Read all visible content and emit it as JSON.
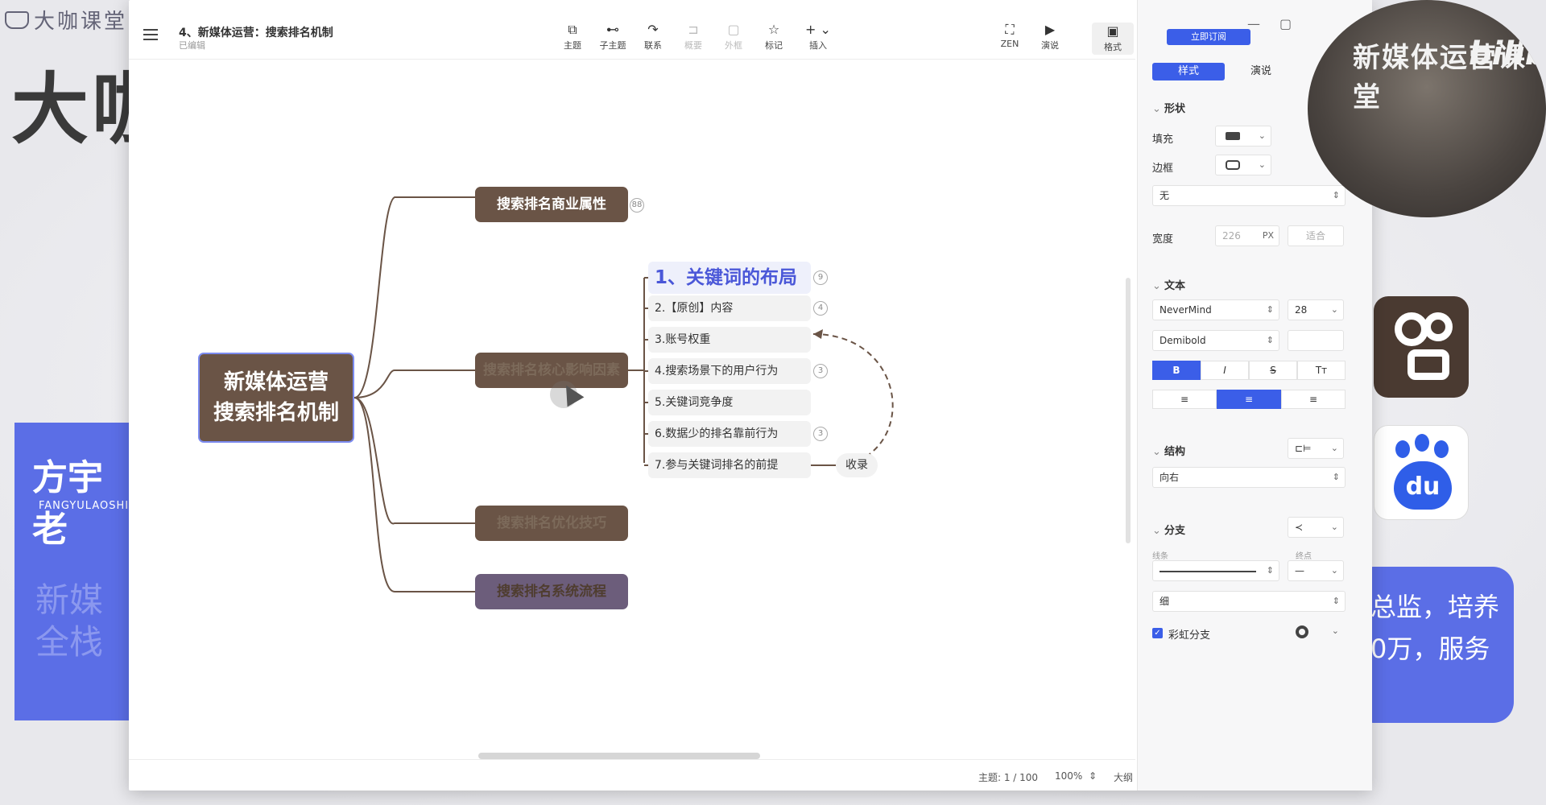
{
  "background": {
    "logo_text": "大咖课堂",
    "big_text": "大咖",
    "card": {
      "name": "方宇老",
      "en": "FANGYULAOSHI",
      "lines": [
        "新媒",
        "全栈"
      ]
    },
    "right_text": [
      "总监，培养",
      "0万，服务"
    ],
    "camera_watermark": "新媒体运营课堂",
    "camera_brand": "bilibili",
    "baidu_label": "du"
  },
  "window": {
    "doc_title": "4、新媒体运营：搜索排名机制",
    "doc_status": "已编辑",
    "toolbar": [
      {
        "label": "主题",
        "icon": "⧉",
        "enabled": true
      },
      {
        "label": "子主题",
        "icon": "⊷",
        "enabled": true
      },
      {
        "label": "联系",
        "icon": "↷",
        "enabled": true
      },
      {
        "label": "概要",
        "icon": "⊐",
        "enabled": false
      },
      {
        "label": "外框",
        "icon": "▢",
        "enabled": false
      },
      {
        "label": "标记",
        "icon": "☆",
        "enabled": true
      },
      {
        "label": "插入",
        "icon": "+ ⌄",
        "enabled": true
      },
      {
        "label": "ZEN",
        "icon": "⛶",
        "enabled": true
      },
      {
        "label": "演说",
        "icon": "▶",
        "enabled": true
      },
      {
        "label": "格式",
        "icon": "▣",
        "enabled": true
      }
    ],
    "status": {
      "topic": "主题: 1 / 100",
      "zoom": "100%",
      "outline": "大纲"
    }
  },
  "mindmap": {
    "root": {
      "line1": "新媒体运营",
      "line2": "搜索排名机制"
    },
    "mains": [
      {
        "label": "搜索排名商业属性",
        "badge": "88"
      },
      {
        "label": "搜索排名核心影响因素",
        "badge": ""
      },
      {
        "label": "搜索排名优化技巧",
        "badge": ""
      },
      {
        "label": "搜索排名系统流程",
        "badge": ""
      }
    ],
    "subs": [
      {
        "label": "1、关键词的布局",
        "badge": "9"
      },
      {
        "label": "2.【原创】内容",
        "badge": "4"
      },
      {
        "label": "3.账号权重",
        "badge": ""
      },
      {
        "label": "4.搜索场景下的用户行为",
        "badge": "3"
      },
      {
        "label": "5.关键词竞争度",
        "badge": ""
      },
      {
        "label": "6.数据少的排名靠前行为",
        "badge": "3"
      },
      {
        "label": "7.参与关键词排名的前提",
        "badge": ""
      }
    ],
    "collect_label": "收录"
  },
  "panel": {
    "subscribe": "立即订阅",
    "tabs": [
      "样式",
      "演说"
    ],
    "shape_section": "形状",
    "fill_label": "填充",
    "border_label": "边框",
    "border_style": "无",
    "width_label": "宽度",
    "width_value": "226",
    "width_unit": "PX",
    "fit_label": "适合",
    "text_section": "文本",
    "font_name": "NeverMind",
    "font_size": "28",
    "font_weight": "Demibold",
    "format_buttons": [
      "B",
      "I",
      "S",
      "Tт"
    ],
    "align_buttons": [
      "≡",
      "≡",
      "≡"
    ],
    "structure_section": "结构",
    "direction": "向右",
    "branch_section": "分支",
    "line_label": "线条",
    "end_label": "终点",
    "thickness": "细",
    "rainbow_label": "彩虹分支",
    "accent": "#3b5ee8",
    "node_color": "#6a5446"
  }
}
